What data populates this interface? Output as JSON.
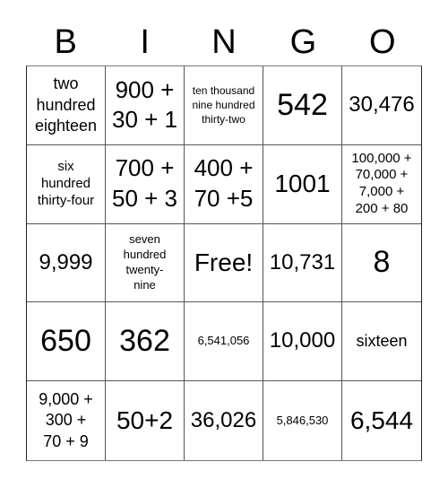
{
  "card": {
    "header": [
      "B",
      "I",
      "N",
      "G",
      "O"
    ],
    "rows": [
      [
        {
          "text": "two\nhundred\neighteen",
          "size": "s-ms"
        },
        {
          "text": "900 +\n30 + 1",
          "size": "s-lm"
        },
        {
          "text": "ten thousand\nnine hundred\nthirty-two",
          "size": "s-xs"
        },
        {
          "text": "542",
          "size": "s-xl"
        },
        {
          "text": "30,476",
          "size": "s-m"
        }
      ],
      [
        {
          "text": "six\nhundred\nthirty-four",
          "size": "s-sm"
        },
        {
          "text": "700 +\n50 + 3",
          "size": "s-lm"
        },
        {
          "text": "400 +\n70 +5",
          "size": "s-lm"
        },
        {
          "text": "1001",
          "size": "s-l"
        },
        {
          "text": "100,000 +\n70,000 +\n7,000 +\n200 + 80",
          "size": "s-sm"
        }
      ],
      [
        {
          "text": "9,999",
          "size": "s-m"
        },
        {
          "text": "seven\nhundred\ntwenty-\nnine",
          "size": "s-s"
        },
        {
          "text": "Free!",
          "size": "s-l"
        },
        {
          "text": "10,731",
          "size": "s-m"
        },
        {
          "text": "8",
          "size": "s-xl"
        }
      ],
      [
        {
          "text": "650",
          "size": "s-xl"
        },
        {
          "text": "362",
          "size": "s-xl"
        },
        {
          "text": "6,541,056",
          "size": "s-s"
        },
        {
          "text": "10,000",
          "size": "s-m"
        },
        {
          "text": "sixteen",
          "size": "s-ms"
        }
      ],
      [
        {
          "text": "9,000 +\n300 +\n70 + 9",
          "size": "s-ms"
        },
        {
          "text": "50+2",
          "size": "s-l"
        },
        {
          "text": "36,026",
          "size": "s-m"
        },
        {
          "text": "5,846,530",
          "size": "s-s"
        },
        {
          "text": "6,544",
          "size": "s-l"
        }
      ]
    ]
  }
}
